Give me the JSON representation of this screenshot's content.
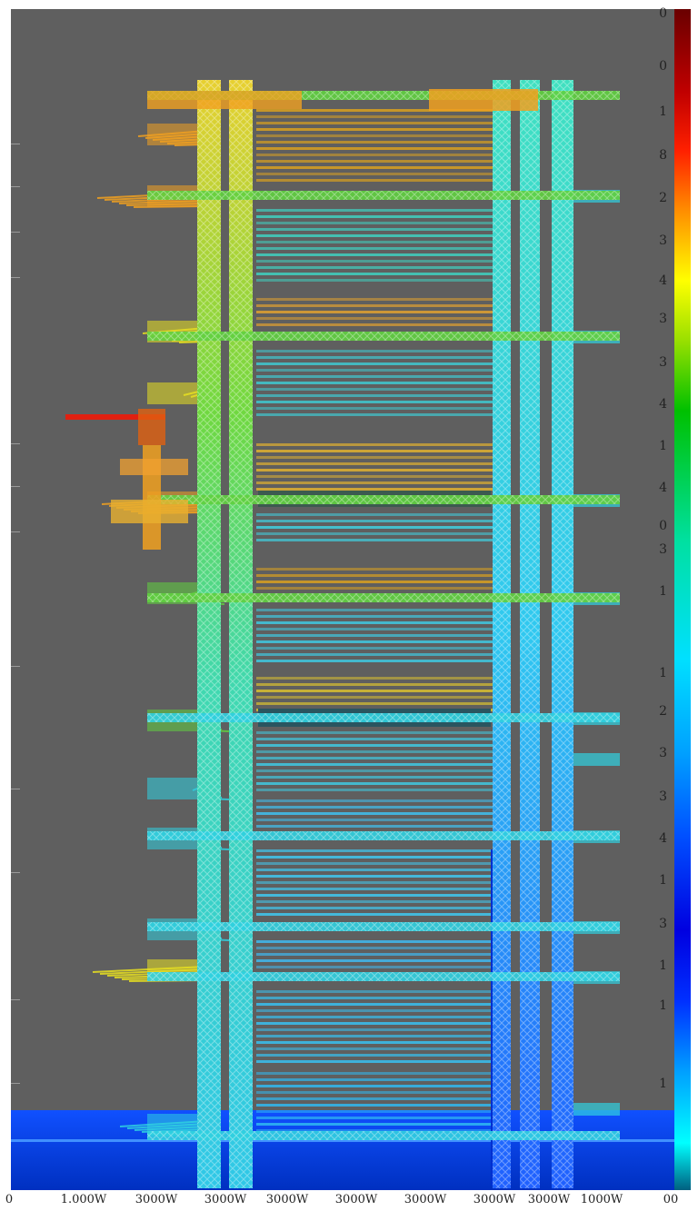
{
  "colorbar": {
    "labels": [
      "0",
      "0",
      "1",
      "8",
      "2",
      "3",
      "4",
      "3",
      "3",
      "4",
      "1",
      "4",
      "0",
      "3",
      "1",
      "1",
      "2",
      "3",
      "3",
      "4",
      "1",
      "3",
      "1",
      "1",
      "1"
    ],
    "colors": [
      "#6a0000",
      "#c00000",
      "#ff2000",
      "#ff8c00",
      "#ffff00",
      "#00c000",
      "#00e0ff",
      "#0050ff",
      "#0000e0",
      "#00ffff"
    ]
  },
  "x_axis": {
    "labels": [
      "0",
      "1.000W",
      "3000W",
      "3000W",
      "3000W",
      "3000W",
      "3000W",
      "3000W",
      "3000W",
      "1000W",
      "00"
    ]
  },
  "structure": {
    "background": "#5f5f5f",
    "levels": 16,
    "palette": {
      "red": "#e02010",
      "orange": "#f0a020",
      "yellow": "#e8e020",
      "green": "#60d040",
      "cyan": "#30d0e0",
      "blue": "#1060ff",
      "deep_blue": "#0030d0"
    }
  }
}
